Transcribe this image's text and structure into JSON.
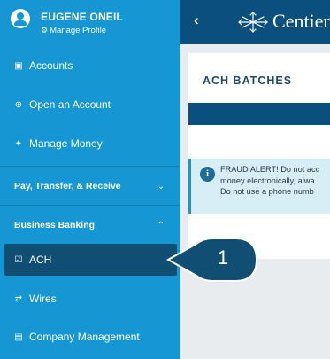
{
  "profile": {
    "name": "EUGENE ONEIL",
    "manage_label": "Manage Profile",
    "manage_icon": "gear-icon"
  },
  "sidebar": {
    "items": [
      {
        "label": "Accounts",
        "icon": "accounts-icon"
      },
      {
        "label": "Open an Account",
        "icon": "plus-circle-icon"
      },
      {
        "label": "Manage Money",
        "icon": "piggy-bank-icon"
      }
    ],
    "sections": [
      {
        "label": "Pay, Transfer, & Receive",
        "state": "collapsed"
      },
      {
        "label": "Business Banking",
        "state": "expanded"
      }
    ],
    "business_items": [
      {
        "label": "ACH",
        "icon": "checkbox-icon",
        "active": true
      },
      {
        "label": "Wires",
        "icon": "transfer-arrows-icon"
      },
      {
        "label": "Company Management",
        "icon": "building-icon"
      }
    ]
  },
  "topbar": {
    "brand": "Centier",
    "back_icon": "chevron-left-icon"
  },
  "main": {
    "title": "ACH BATCHES",
    "alert_lines": [
      "FRAUD ALERT! Do not acc",
      "money electronically, alwa",
      "Do not use a phone numb"
    ]
  },
  "callout": {
    "number": "1"
  },
  "colors": {
    "sidebar": "#1696d2",
    "active_item": "#114e73",
    "topbar": "#0a4f7e",
    "alert_bg": "#d8eef7",
    "callout": "#114e73"
  }
}
